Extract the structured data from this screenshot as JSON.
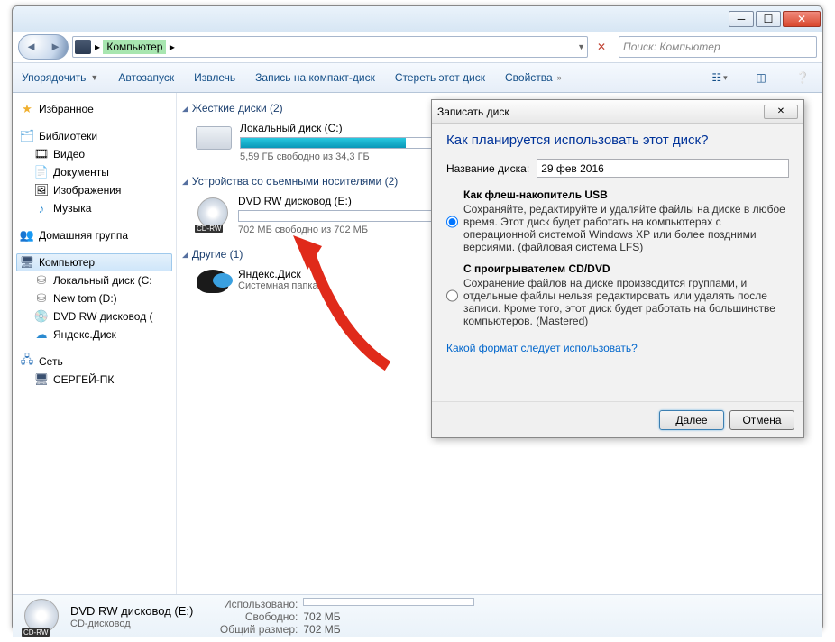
{
  "breadcrumb": {
    "root": "Компьютер",
    "arrow": "▸"
  },
  "search": {
    "placeholder": "Поиск: Компьютер"
  },
  "toolbar": {
    "organize": "Упорядочить",
    "autoplay": "Автозапуск",
    "eject": "Извлечь",
    "burn": "Запись на компакт-диск",
    "erase": "Стереть этот диск",
    "properties": "Свойства"
  },
  "sidebar": {
    "favorites": "Избранное",
    "libraries": "Библиотеки",
    "videos": "Видео",
    "documents": "Документы",
    "pictures": "Изображения",
    "music": "Музыка",
    "homegroup": "Домашняя группа",
    "computer": "Компьютер",
    "localdisk": "Локальный диск (С:",
    "newtom": "New tom (D:)",
    "dvdrw_side": "DVD RW дисковод (",
    "yandex": "Яндекс.Диск",
    "network": "Сеть",
    "pcname": "СЕРГЕЙ-ПК"
  },
  "groups": {
    "hdd": "Жесткие диски (2)",
    "removable": "Устройства со съемными носителями (2)",
    "other": "Другие (1)"
  },
  "drives": {
    "c_name": "Локальный диск (С:)",
    "c_free": "5,59 ГБ свободно из 34,3 ГБ",
    "c_fill_pct": 84,
    "dvdrw_name": "DVD RW дисковод (E:)",
    "dvdrw_free": "702 МБ свободно из 702 МБ",
    "yd_name": "Яндекс.Диск",
    "yd_sub": "Системная папка",
    "cdrw_label": "CD-RW"
  },
  "dialog": {
    "title": "Записать диск",
    "question": "Как планируется использовать этот диск?",
    "name_label": "Название диска:",
    "name_value": "29 фев 2016",
    "opt1_title": "Как флеш-накопитель USB",
    "opt1_desc": "Сохраняйте, редактируйте и удаляйте файлы на диске в любое время. Этот диск будет работать на компьютерах с операционной системой Windows XP или более поздними версиями. (файловая система LFS)",
    "opt2_title": "С проигрывателем CD/DVD",
    "opt2_desc": "Сохранение файлов на диске производится группами, и отдельные файлы нельзя редактировать или удалять после записи. Кроме того, этот диск будет работать на большинстве компьютеров. (Mastered)",
    "link": "Какой формат следует использовать?",
    "next": "Далее",
    "cancel": "Отмена"
  },
  "status": {
    "name": "DVD RW дисковод (E:)",
    "sub": "CD-дисковод",
    "used_label": "Использовано:",
    "free_label": "Свободно:",
    "free_val": "702 МБ",
    "total_label": "Общий размер:",
    "total_val": "702 МБ"
  }
}
